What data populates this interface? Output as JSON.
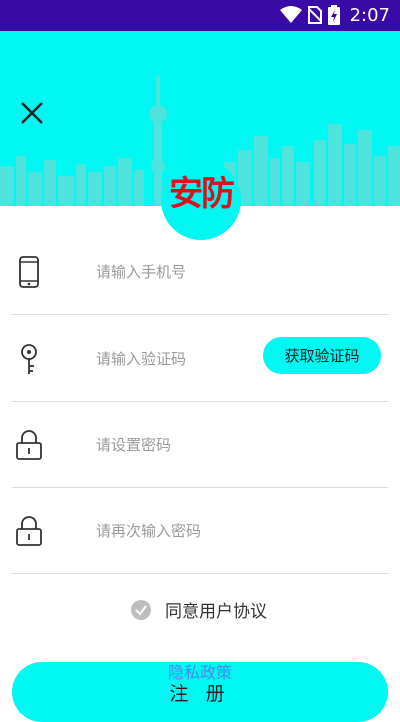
{
  "status_bar": {
    "time": "2:07"
  },
  "header": {
    "logo_text": "安防"
  },
  "form": {
    "phone_placeholder": "请输入手机号",
    "code_placeholder": "请输入验证码",
    "get_code_label": "获取验证码",
    "password_placeholder": "请设置密码",
    "confirm_password_placeholder": "请再次输入密码"
  },
  "agreement": {
    "label": "同意用户协议"
  },
  "privacy": {
    "label": "隐私政策"
  },
  "register": {
    "label": "注 册"
  },
  "colors": {
    "accent": "#00f7f2",
    "status_bar": "#3a0aa6",
    "logo": "#d9131e",
    "link": "#3f8fe8"
  }
}
